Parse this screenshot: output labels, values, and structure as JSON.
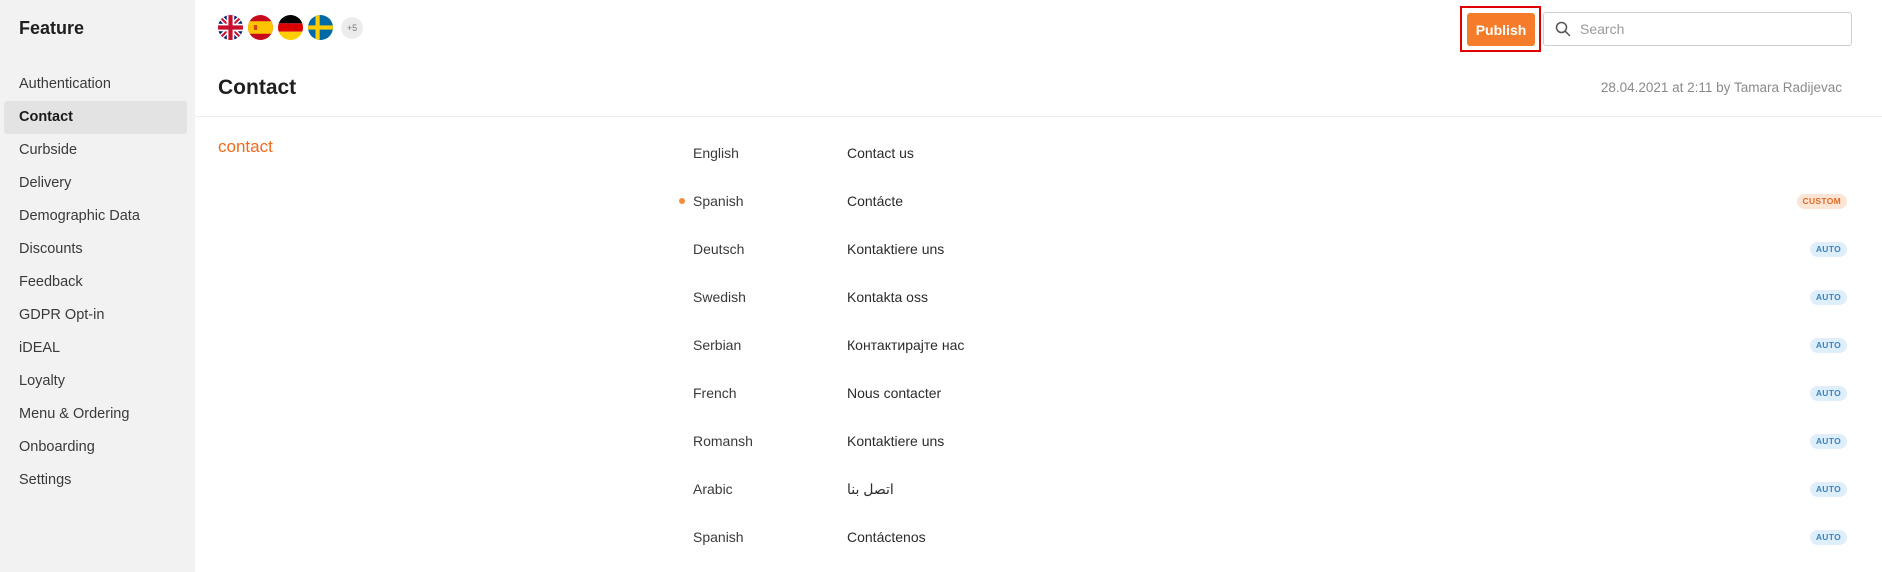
{
  "sidebar": {
    "title": "Feature",
    "items": [
      {
        "label": "Authentication"
      },
      {
        "label": "Contact"
      },
      {
        "label": "Curbside"
      },
      {
        "label": "Delivery"
      },
      {
        "label": "Demographic Data"
      },
      {
        "label": "Discounts"
      },
      {
        "label": "Feedback"
      },
      {
        "label": "GDPR Opt-in"
      },
      {
        "label": "iDEAL"
      },
      {
        "label": "Loyalty"
      },
      {
        "label": "Menu & Ordering"
      },
      {
        "label": "Onboarding"
      },
      {
        "label": "Settings"
      }
    ],
    "active_item": "Contact"
  },
  "header": {
    "flags": [
      "uk-flag-icon",
      "spain-flag-icon",
      "germany-flag-icon",
      "sweden-flag-icon"
    ],
    "more_flags": "+5",
    "publish_label": "Publish",
    "search_placeholder": "Search",
    "search_value": ""
  },
  "page": {
    "title": "Contact",
    "meta": "28.04.2021 at 2:11 by Tamara Radijevac",
    "key": "contact"
  },
  "translations": [
    {
      "language": "English",
      "value": "Contact us",
      "badge": ""
    },
    {
      "language": "Spanish",
      "value": "Contácte",
      "badge": "CUSTOM",
      "modified": true
    },
    {
      "language": "Deutsch",
      "value": "Kontaktiere uns",
      "badge": "AUTO"
    },
    {
      "language": "Swedish",
      "value": "Kontakta oss",
      "badge": "AUTO"
    },
    {
      "language": "Serbian",
      "value": "Контактирајте нас",
      "badge": "AUTO"
    },
    {
      "language": "French",
      "value": "Nous contacter",
      "badge": "AUTO"
    },
    {
      "language": "Romansh",
      "value": "Kontaktiere uns",
      "badge": "AUTO"
    },
    {
      "language": "Arabic",
      "value": "اتصل بنا",
      "badge": "AUTO"
    },
    {
      "language": "Spanish",
      "value": "Contáctenos",
      "badge": "AUTO"
    }
  ],
  "colors": {
    "accent": "#f57c2b",
    "highlight_border": "#e00000",
    "auto_badge_bg": "#dfeefb",
    "custom_badge_bg": "#fde5d5"
  }
}
